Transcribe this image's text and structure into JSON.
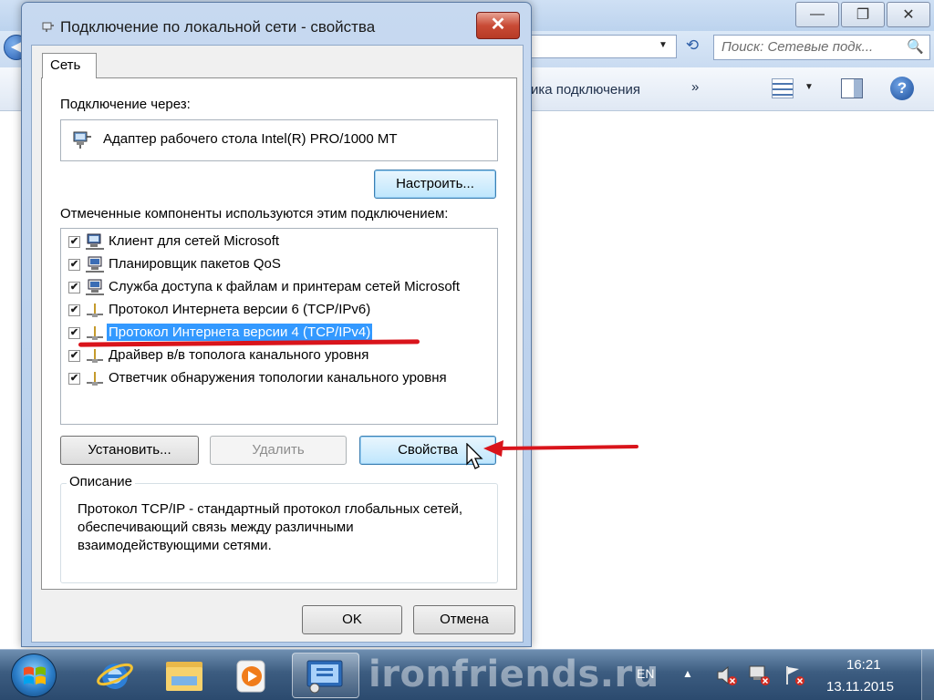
{
  "background_window": {
    "search_placeholder": "Поиск: Сетевые подк...",
    "toolbar_partial_label": "ика подключения",
    "toolbar_more": "»",
    "minimize_glyph": "—",
    "restore_glyph": "❐",
    "close_glyph": "✕",
    "back_glyph": "◀",
    "dropdown_glyph": "▼",
    "refresh_glyph": "⟲",
    "search_glyph": "🔍",
    "help_glyph": "?"
  },
  "dialog": {
    "title": "Подключение по локальной сети - свойства",
    "close_glyph": "✕",
    "tab_label": "Сеть",
    "connect_via_label": "Подключение через:",
    "adapter_name": "Адаптер рабочего стола Intel(R) PRO/1000 MT",
    "configure_button": "Настроить...",
    "components_label": "Отмеченные компоненты используются этим подключением:",
    "components": [
      {
        "label": "Клиент для сетей Microsoft",
        "checked": true,
        "icon": "network-client-icon",
        "selected": false
      },
      {
        "label": "Планировщик пакетов QoS",
        "checked": true,
        "icon": "network-service-icon",
        "selected": false
      },
      {
        "label": "Служба доступа к файлам и принтерам сетей Microsoft",
        "checked": true,
        "icon": "network-service-icon",
        "selected": false
      },
      {
        "label": "Протокол Интернета версии 6 (TCP/IPv6)",
        "checked": true,
        "icon": "protocol-icon",
        "selected": false
      },
      {
        "label": "Протокол Интернета версии 4 (TCP/IPv4)",
        "checked": true,
        "icon": "protocol-icon",
        "selected": true
      },
      {
        "label": "Драйвер в/в тополога канального уровня",
        "checked": true,
        "icon": "protocol-icon",
        "selected": false
      },
      {
        "label": "Ответчик обнаружения топологии канального уровня",
        "checked": true,
        "icon": "protocol-icon",
        "selected": false
      }
    ],
    "check_glyph": "✔",
    "install_button": "Установить...",
    "remove_button": "Удалить",
    "properties_button": "Свойства",
    "description_legend": "Описание",
    "description_text": "Протокол TCP/IP - стандартный протокол глобальных сетей, обеспечивающий связь между различными взаимодействующими сетями.",
    "ok_button": "OK",
    "cancel_button": "Отмена"
  },
  "taskbar": {
    "watermark": "ironfriends.ru",
    "language": "EN",
    "tray_arrow": "▲",
    "time": "16:21",
    "date": "13.11.2015"
  },
  "colors": {
    "selection": "#3399ff",
    "annotation_red": "#d9141b",
    "close_button": "#c94b36"
  }
}
